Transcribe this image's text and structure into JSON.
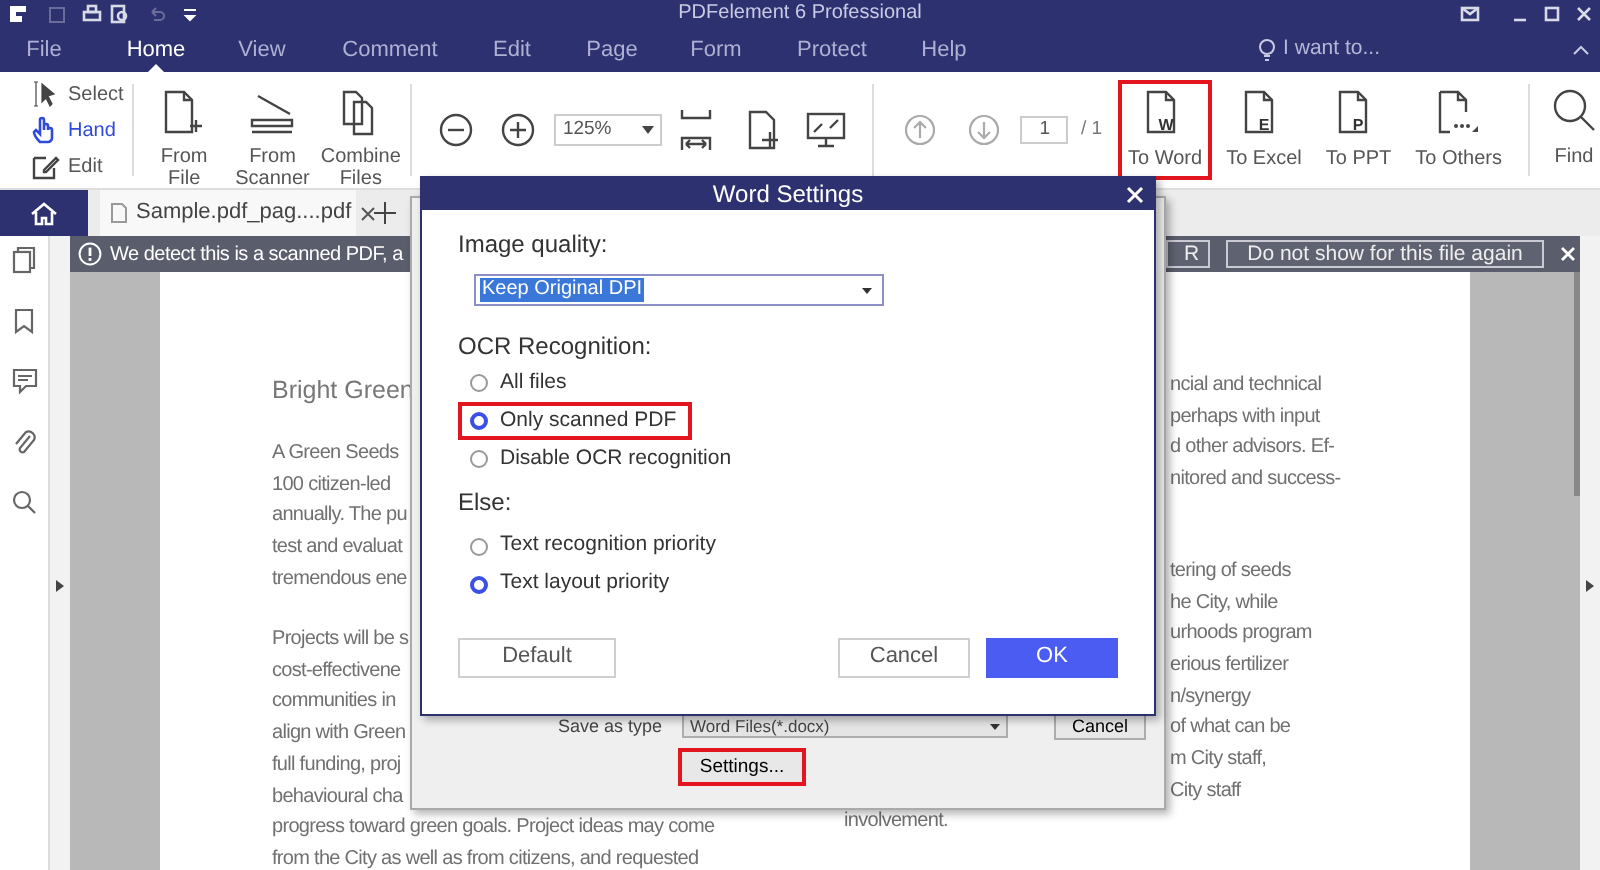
{
  "title_bar": {
    "title": "PDFelement 6 Professional"
  },
  "menu_tabs": [
    {
      "label": "File",
      "selected": false
    },
    {
      "label": "Home",
      "selected": true
    },
    {
      "label": "View",
      "selected": false
    },
    {
      "label": "Comment",
      "selected": false
    },
    {
      "label": "Edit",
      "selected": false
    },
    {
      "label": "Page",
      "selected": false
    },
    {
      "label": "Form",
      "selected": false
    },
    {
      "label": "Protect",
      "selected": false
    },
    {
      "label": "Help",
      "selected": false
    }
  ],
  "help_prompt": "I want to...",
  "toolbar": {
    "edit_modes": [
      {
        "label": "Select",
        "kind": "select",
        "selected": false
      },
      {
        "label": "Hand",
        "kind": "hand",
        "selected": true
      },
      {
        "label": "Edit",
        "kind": "edit",
        "selected": false
      }
    ],
    "create": [
      {
        "label": "From File",
        "kind": "file"
      },
      {
        "label": "From Scanner",
        "kind": "scanner"
      },
      {
        "label": "Combine Files",
        "kind": "combine"
      }
    ],
    "zoom": "125%",
    "page_input": "1",
    "page_total": "/ 1",
    "convert": [
      {
        "label": "To Word",
        "letter": "W",
        "highlighted": true
      },
      {
        "label": "To Excel",
        "letter": "E",
        "highlighted": false
      },
      {
        "label": "To PPT",
        "letter": "P",
        "highlighted": false
      },
      {
        "label": "To Others",
        "highlighted": false
      }
    ],
    "find": "Find"
  },
  "document_tab": {
    "title": "Sample.pdf_pag....pdf"
  },
  "notice": {
    "message": "We detect this is a scanned PDF, a",
    "buttons": [
      "R",
      "Do not show for this file again"
    ]
  },
  "page": {
    "left_column": [
      {
        "kind": "heading",
        "lines": [
          "Bright Green"
        ]
      },
      {
        "kind": "paragraph",
        "lines": [
          "A Green Seeds",
          "100 citizen-led",
          "annually. The pu",
          "test and evaluat",
          "tremendous ene"
        ]
      },
      {
        "kind": "paragraph",
        "lines": [
          "Projects will be s",
          "cost-effectivene",
          "communities in",
          "align with Green",
          "full funding, proj",
          "behavioural cha",
          "progress toward green goals. Project ideas may come",
          "from the City as well as from citizens, and requested"
        ]
      }
    ],
    "right_column": [
      {
        "kind": "paragraph",
        "lines": [
          {
            "text": "ncial and technical",
            "clipped": true
          },
          {
            "text": "perhaps with input",
            "clipped": true
          },
          {
            "text": "d other advisors. Ef-",
            "clipped": true
          },
          {
            "text": "nitored and success-",
            "clipped": true
          }
        ]
      },
      {
        "kind": "paragraph",
        "lines": [
          {
            "text": "tering of seeds",
            "clipped": true
          },
          {
            "text": "he City, while",
            "clipped": true
          },
          {
            "text": "urhoods program",
            "clipped": true
          },
          {
            "text": "erious fertilizer",
            "clipped": true
          },
          {
            "text": "n/synergy",
            "clipped": true
          },
          {
            "text": "of what can be",
            "clipped": true
          },
          {
            "text": "m City staff,",
            "clipped": true
          },
          {
            "text": "City staff",
            "clipped": true
          },
          {
            "text": "involvement.",
            "clipped": false
          }
        ]
      }
    ]
  },
  "save_dialog": {
    "type_label": "Save as type",
    "file_type": "Word Files(*.docx)",
    "cancel": "Cancel",
    "settings": {
      "label": "Settings...",
      "highlighted": true
    }
  },
  "word_settings": {
    "title": "Word Settings",
    "image_quality_label": "Image quality:",
    "image_quality": "Keep Original DPI",
    "ocr_label": "OCR Recognition:",
    "ocr_options": [
      {
        "label": "All files",
        "selected": false,
        "highlighted": false
      },
      {
        "label": "Only scanned PDF",
        "selected": true,
        "highlighted": true
      },
      {
        "label": "Disable OCR recognition",
        "selected": false,
        "highlighted": false
      }
    ],
    "else_label": "Else:",
    "else_options": [
      {
        "label": "Text recognition priority",
        "selected": false,
        "highlighted": false
      },
      {
        "label": "Text layout priority",
        "selected": true,
        "highlighted": false
      }
    ],
    "buttons": [
      {
        "label": "Default",
        "kind": "secondary"
      },
      {
        "label": "Cancel",
        "kind": "secondary"
      },
      {
        "label": "OK",
        "kind": "primary"
      }
    ]
  }
}
